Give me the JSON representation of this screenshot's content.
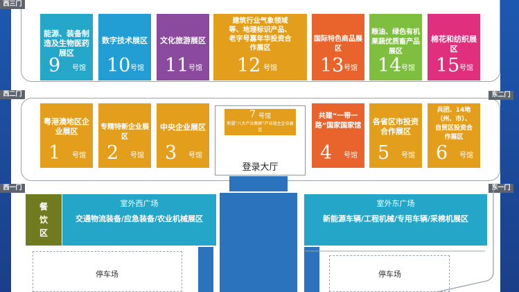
{
  "gates": {
    "west3": "西三门",
    "west2": "西二门",
    "east2": "东二门",
    "west1": "西一门",
    "east1": "东一门"
  },
  "hall_suffix": "号馆",
  "top_row": [
    {
      "label": "能源、装备制造及生物医药展区",
      "number": "9",
      "color": "#24a7c9"
    },
    {
      "label": "数字技术展区",
      "number": "10",
      "color": "#239ed4"
    },
    {
      "label": "文化旅游展区",
      "number": "11",
      "color": "#8b4a9e"
    },
    {
      "label": "建筑行业气象领域等、地理标识产品、老字号嘉年华投资合作展区",
      "number": "12",
      "color": "#e39f1b"
    },
    {
      "label": "国际特色商品展区",
      "number": "13",
      "color": "#e8642c"
    },
    {
      "label": "粮油、绿色有机果蔬优质畜产品展区",
      "number": "14",
      "color": "#7fbf3f"
    },
    {
      "label": "棉花和纺织展区",
      "number": "15",
      "color": "#e0307d"
    }
  ],
  "middle_row": [
    {
      "label": "粤港澳地区企业展区",
      "number": "1",
      "color": "#e39f1b"
    },
    {
      "label": "专精特新企业展区",
      "number": "2",
      "color": "#e39f1b"
    },
    {
      "label": "中央企业展区",
      "number": "3",
      "color": "#e39f1b"
    },
    {
      "label": "共建“一带一路”国家国家馆",
      "number": "4",
      "color": "#e8642c"
    },
    {
      "label": "各省区市投资合作展区",
      "number": "5",
      "color": "#e39f1b"
    },
    {
      "label": "兵团、14地（州、市）、自贸区投资合作展区",
      "number": "6",
      "color": "#e39f1b"
    }
  ],
  "hall7": {
    "number": "7",
    "suffix": "号馆",
    "label": "新疆“八大产业集群”产业链主企业展区",
    "lobby": "登录大厅",
    "color": "#e39f1b"
  },
  "west_plaza": {
    "name": "室外西广场",
    "desc": "交通物流装备/应急装备/农业机械展区"
  },
  "east_plaza": {
    "name": "室外东广场",
    "desc": "新能源车辆/工程机械/专用车辆/采棉机展区"
  },
  "dining": [
    "餐",
    "饮",
    "区"
  ],
  "parking": [
    "停车场",
    "停车场"
  ]
}
